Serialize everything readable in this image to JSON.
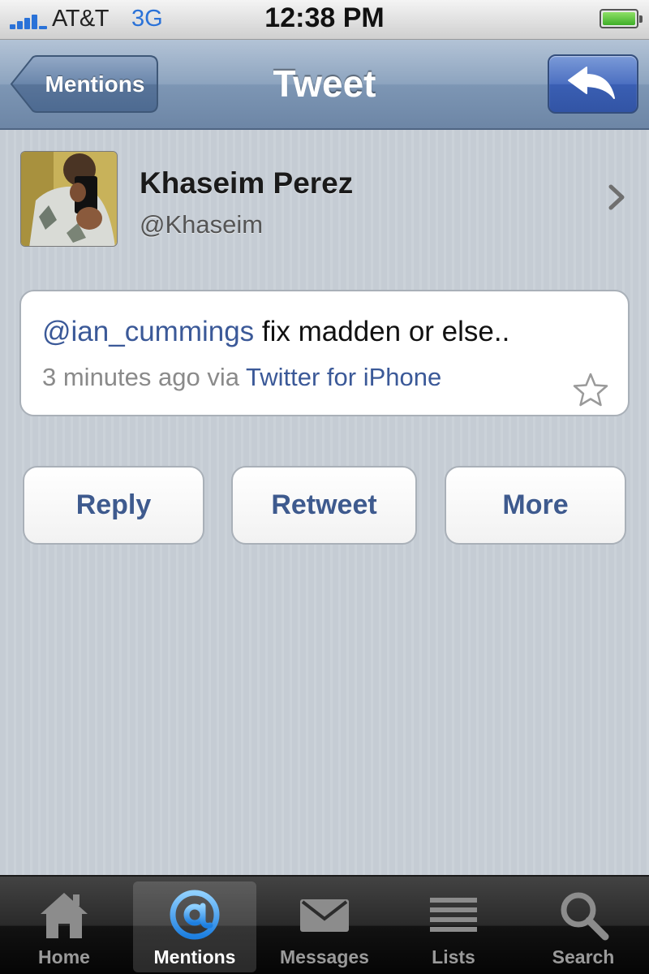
{
  "status_bar": {
    "carrier": "AT&T",
    "network": "3G",
    "time": "12:38 PM",
    "signal_icon": "signal-bars-icon",
    "battery_icon": "battery-full-icon"
  },
  "nav": {
    "back_label": "Mentions",
    "title": "Tweet",
    "action_icon": "reply-arrow-icon"
  },
  "user": {
    "name": "Khaseim Perez",
    "handle": "@Khaseim",
    "avatar_icon": "user-avatar-photo"
  },
  "tweet": {
    "mention": "@ian_cummings",
    "text": " fix madden or else..",
    "time": "3 minutes ago via ",
    "source": "Twitter for iPhone",
    "favorite_icon": "star-outline-icon"
  },
  "actions": {
    "reply": "Reply",
    "retweet": "Retweet",
    "more": "More"
  },
  "tabs": [
    {
      "label": "Home",
      "icon": "home-icon",
      "active": false
    },
    {
      "label": "Mentions",
      "icon": "at-sign-icon",
      "active": true
    },
    {
      "label": "Messages",
      "icon": "envelope-icon",
      "active": false
    },
    {
      "label": "Lists",
      "icon": "list-icon",
      "active": false
    },
    {
      "label": "Search",
      "icon": "search-icon",
      "active": false
    }
  ],
  "colors": {
    "link": "#3b5998",
    "button_text": "#3e5a8e",
    "network": "#2a72d8"
  }
}
